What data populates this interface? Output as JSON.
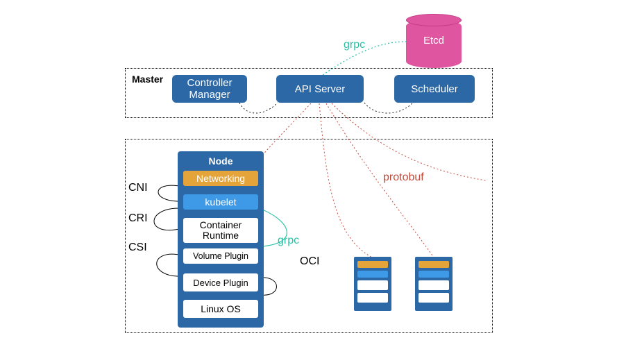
{
  "etcd": {
    "label": "Etcd"
  },
  "links": {
    "grpc_top": "grpc",
    "grpc_side": "grpc",
    "protobuf": "protobuf",
    "oci": "OCI"
  },
  "master": {
    "title": "Master",
    "controller_manager": "Controller\nManager",
    "api_server": "API Server",
    "scheduler": "Scheduler"
  },
  "node": {
    "title": "Node",
    "networking": "Networking",
    "kubelet": "kubelet",
    "container_runtime": "Container\nRuntime",
    "volume_plugin": "Volume Plugin",
    "device_plugin": "Device Plugin",
    "linux_os": "Linux OS"
  },
  "left_labels": {
    "cni": "CNI",
    "cri": "CRI",
    "csi": "CSI"
  }
}
